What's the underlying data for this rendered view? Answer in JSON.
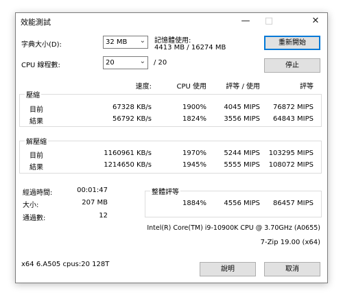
{
  "window": {
    "title": "效能測試"
  },
  "controls": {
    "dict_label": "字典大小(D):",
    "dict_value": "32 MB",
    "threads_label": "CPU 線程數:",
    "threads_value": "20",
    "threads_max": "/ 20",
    "memory_label": "記憶體使用:",
    "memory_value": "4413 MB / 16274 MB"
  },
  "buttons": {
    "restart": "重新開始",
    "stop": "停止",
    "help": "說明",
    "cancel": "取消"
  },
  "headers": {
    "speed": "速度:",
    "cpu": "CPU 使用",
    "rating_usage": "評等 / 使用",
    "rating": "評等"
  },
  "compress": {
    "label": "壓縮",
    "current": {
      "name": "目前",
      "speed": "67328 KB/s",
      "cpu": "1900%",
      "ru": "4045 MIPS",
      "rating": "76872 MIPS"
    },
    "result": {
      "name": "結果",
      "speed": "56792 KB/s",
      "cpu": "1824%",
      "ru": "3556 MIPS",
      "rating": "64843 MIPS"
    }
  },
  "decompress": {
    "label": "解壓縮",
    "current": {
      "name": "目前",
      "speed": "1160961 KB/s",
      "cpu": "1970%",
      "ru": "5244 MIPS",
      "rating": "103295 MIPS"
    },
    "result": {
      "name": "結果",
      "speed": "1214650 KB/s",
      "cpu": "1945%",
      "ru": "5555 MIPS",
      "rating": "108072 MIPS"
    }
  },
  "stats": {
    "elapsed_label": "經過時間:",
    "elapsed_value": "00:01:47",
    "size_label": "大小:",
    "size_value": "207 MB",
    "passes_label": "通過數:",
    "passes_value": "12"
  },
  "total": {
    "label": "整體評等",
    "cpu": "1884%",
    "ru": "4556 MIPS",
    "rating": "86457 MIPS"
  },
  "info": {
    "cpu_name": "Intel(R) Core(TM) i9-10900K CPU @ 3.70GHz (A0655)",
    "version": "7-Zip 19.00 (x64)",
    "system": "x64 6.A505 cpus:20 128T"
  }
}
